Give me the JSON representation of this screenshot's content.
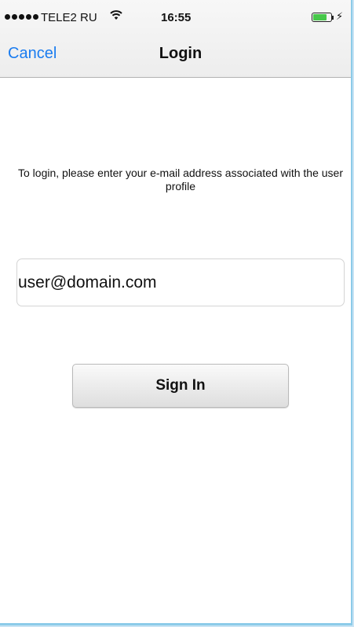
{
  "status_bar": {
    "carrier": "TELE2 RU",
    "time": "16:55",
    "signal_bars": 5,
    "wifi_icon": "wifi-icon",
    "battery_level": 0.75,
    "charging_icon": "bolt-icon"
  },
  "nav": {
    "cancel_label": "Cancel",
    "title": "Login"
  },
  "form": {
    "instruction": "To login, please enter your e-mail address associated with the user profile",
    "email_value": "user@domain.com",
    "signin_label": "Sign In"
  },
  "colors": {
    "accent": "#1a7cf0",
    "battery": "#47c84a",
    "window_frame": "#8ccbe9"
  }
}
